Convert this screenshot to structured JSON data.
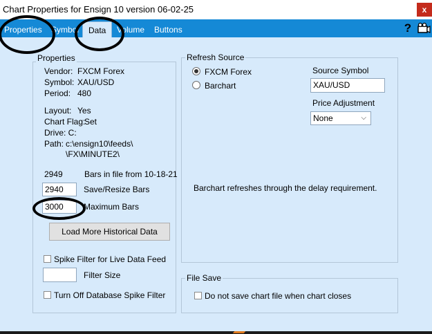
{
  "window": {
    "title": "Chart Properties for Ensign 10 version 06-02-25",
    "close_glyph": "x"
  },
  "tabs": [
    {
      "label": "Properties",
      "active": false
    },
    {
      "label": "Symbol",
      "active": false
    },
    {
      "label": "Data",
      "active": true
    },
    {
      "label": "Volume",
      "active": false
    },
    {
      "label": "Buttons",
      "active": false
    }
  ],
  "toolbar": {
    "help_glyph": "?",
    "camera_icon": "camera-icon"
  },
  "properties": {
    "group_title": "Properties",
    "vendor_label": "Vendor:",
    "vendor_value": "FXCM Forex",
    "symbol_label": "Symbol:",
    "symbol_value": "XAU/USD",
    "period_label": "Period:",
    "period_value": "480",
    "layout_label": "Layout:",
    "layout_value": "Yes",
    "chart_flag_label": "Chart Flag:",
    "chart_flag_value": "Set",
    "drive_label": "Drive: C:",
    "path_label": "Path:",
    "path_line1": "c:\\ensign10\\feeds\\",
    "path_line2": "\\FX\\MINUTE2\\",
    "bars_count": "2949",
    "bars_in_file": "Bars in file from 10-18-21",
    "save_resize_value": "2940",
    "save_resize_label": "Save/Resize Bars",
    "max_bars_value": "3000",
    "max_bars_label": "Maximum Bars",
    "load_more_button": "Load More Historical Data",
    "spike_live_label": "Spike Filter for Live Data Feed",
    "filter_size_value": "",
    "filter_size_label": "Filter Size",
    "db_spike_label": "Turn Off Database Spike Filter"
  },
  "refresh": {
    "group_title": "Refresh Source",
    "option1": "FXCM Forex",
    "option1_selected": true,
    "option2": "Barchart",
    "option2_selected": false,
    "source_symbol_label": "Source Symbol",
    "source_symbol_value": "XAU/USD",
    "price_adj_label": "Price Adjustment",
    "price_adj_value": "None",
    "note": "Barchart refreshes through the delay requirement."
  },
  "file_save": {
    "group_title": "File Save",
    "checkbox_label": "Do not save chart file when chart closes",
    "checked": false
  }
}
